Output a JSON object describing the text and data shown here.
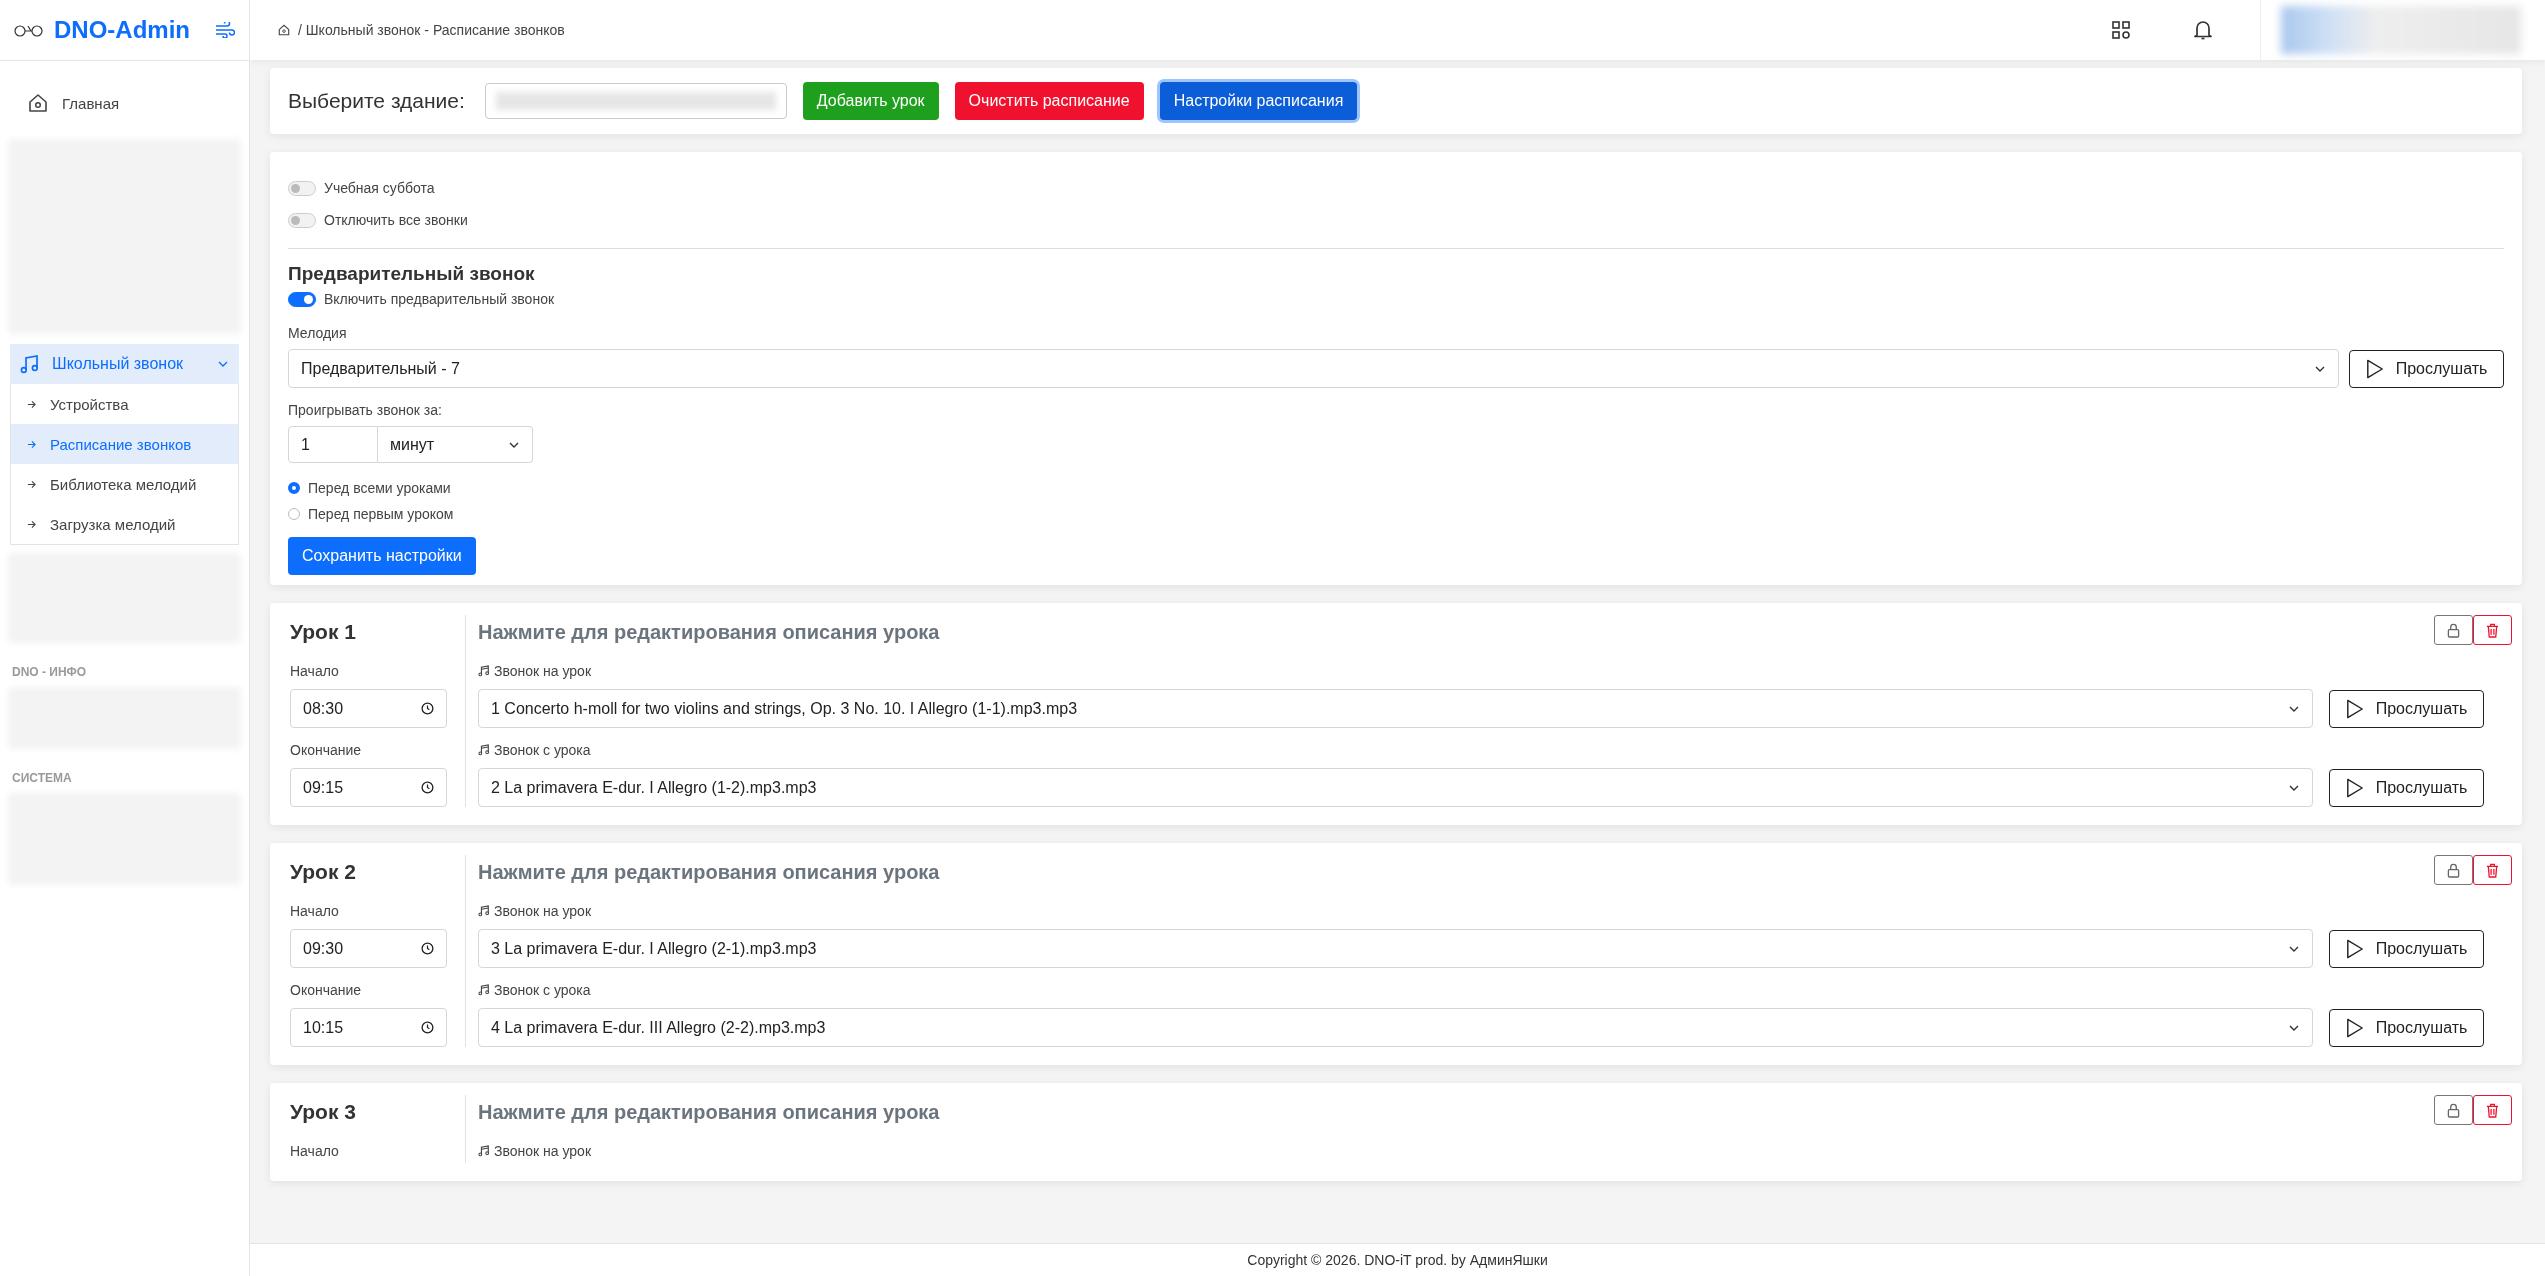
{
  "sidebar": {
    "brand": "DNO-Admin",
    "home": {
      "label": "Главная",
      "selected": false
    },
    "group": {
      "label": "Школьный звонок",
      "expanded": true,
      "children": [
        {
          "label": "Устройства",
          "selected": false
        },
        {
          "label": "Расписание звонков",
          "selected": true
        },
        {
          "label": "Библиотека мелодий",
          "selected": false
        },
        {
          "label": "Загрузка мелодий",
          "selected": false
        }
      ]
    },
    "sections": [
      {
        "label": "DNO - ИНФО"
      },
      {
        "label": "СИСТЕМА"
      }
    ]
  },
  "breadcrumb": "/ Школьный звонок - Расписание звонков",
  "toolbar": {
    "label": "Выберите здание:",
    "buttons": [
      {
        "label": "Добавить урок",
        "kind": "success"
      },
      {
        "label": "Очистить расписание",
        "kind": "danger"
      },
      {
        "label": "Настройки расписания",
        "kind": "primary"
      }
    ]
  },
  "settings": {
    "switches": [
      {
        "label": "Учебная суббота",
        "on": false
      },
      {
        "label": "Отключить все звонки",
        "on": false
      }
    ],
    "title": "Предварительный звонок",
    "enable": {
      "label": "Включить предварительный звонок",
      "on": true
    },
    "melody_label": "Мелодия",
    "melody": "Предварительный - 7",
    "play": "Прослушать",
    "lead_label": "Проигрывать звонок за:",
    "lead_value": "1",
    "lead_unit": "минут",
    "options": [
      {
        "label": "Перед всеми уроками",
        "selected": true
      },
      {
        "label": "Перед первым уроком",
        "selected": false
      }
    ],
    "save": "Сохранить настройки"
  },
  "lessons": [
    {
      "title": "Урок 1",
      "description": "Нажмите для редактирования описания урока",
      "times": [
        {
          "label": "Начало",
          "value": "08:30"
        },
        {
          "label": "Окончание",
          "value": "09:15"
        }
      ],
      "bells": [
        {
          "label": "Звонок на урок",
          "melody": "1 Concerto h-moll for two violins and strings, Op. 3 No. 10. I Allegro (1-1).mp3.mp3",
          "play": "Прослушать"
        },
        {
          "label": "Звонок с урока",
          "melody": "2 La primavera E-dur. I Allegro (1-2).mp3.mp3",
          "play": "Прослушать"
        }
      ]
    },
    {
      "title": "Урок 2",
      "description": "Нажмите для редактирования описания урока",
      "times": [
        {
          "label": "Начало",
          "value": "09:30"
        },
        {
          "label": "Окончание",
          "value": "10:15"
        }
      ],
      "bells": [
        {
          "label": "Звонок на урок",
          "melody": "3 La primavera E-dur. I Allegro (2-1).mp3.mp3",
          "play": "Прослушать"
        },
        {
          "label": "Звонок с урока",
          "melody": "4 La primavera E-dur. III Allegro (2-2).mp3.mp3",
          "play": "Прослушать"
        }
      ]
    },
    {
      "title": "Урок 3",
      "description": "Нажмите для редактирования описания урока",
      "times": [
        {
          "label": "Начало"
        }
      ],
      "bells": [
        {
          "label": "Звонок на урок"
        }
      ]
    }
  ],
  "footer": "Copyright © 2026. DNO-iT prod. by АдминЯшки"
}
